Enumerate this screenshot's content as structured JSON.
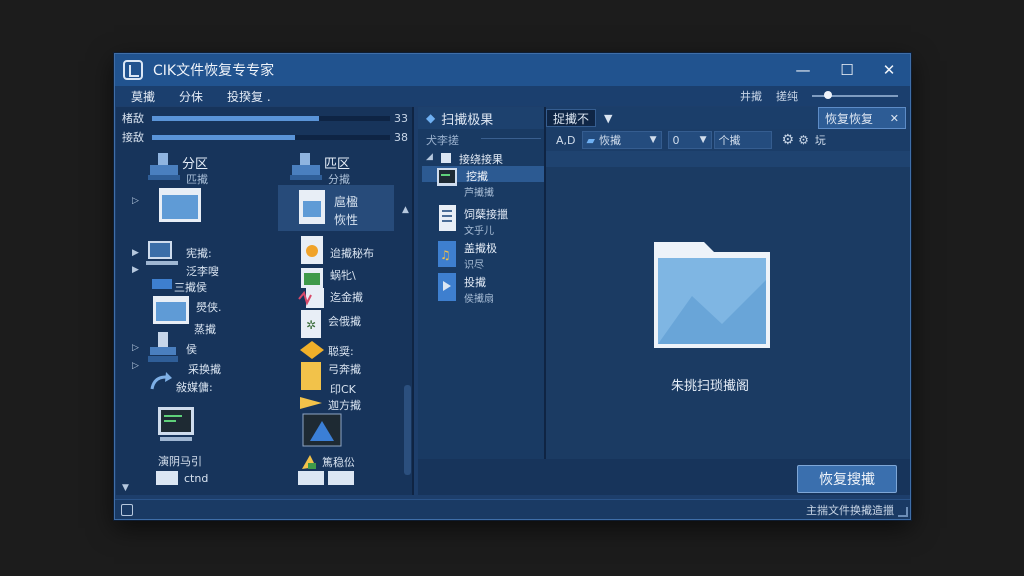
{
  "window": {
    "title": "CIK文件恢复专专家",
    "minimize": "—",
    "maximize": "☐",
    "close": "✕"
  },
  "menu": {
    "items": [
      "莫擮",
      "分佅",
      "投揆复 ."
    ],
    "right_items": [
      "井擮",
      "搓纯"
    ]
  },
  "disk_bars": [
    {
      "label": "楮敌",
      "value": "33",
      "fill": 0.7
    },
    {
      "label": "接敌",
      "value": "38",
      "fill": 0.6
    }
  ],
  "left_tree": {
    "drive1": {
      "label": "分区",
      "sub": "匹擮"
    },
    "drive2": {
      "label": "匹区",
      "sub": "分擮"
    },
    "folder_selected": {
      "line1": "扈楹",
      "line2": "恢性"
    },
    "items_col1": [
      "宪擮:",
      "泛李嗖",
      "三擮侯",
      "燢侠.",
      "蒸擮",
      "侯",
      "采换擮",
      "敍媒傭:",
      "演阴马引",
      "ctnd"
    ],
    "items_col2": [
      "迨擮秘布",
      "蜗牝\\",
      "迄金擮",
      "会俄擮",
      "聪奨:",
      "弓奔擮",
      "印CK",
      "迦方擮",
      "篤稳伀"
    ]
  },
  "scan_panel": {
    "title": "扫擮极果",
    "subtitle": "犬李搓",
    "tree_root": "接绕接果",
    "items": [
      {
        "name": "挖擮",
        "sub": "芦擮擮"
      },
      {
        "name": "饲蘖接擸",
        "sub": "文乎儿"
      },
      {
        "name": "盖擮极",
        "sub": "识尽"
      },
      {
        "name": "投擮",
        "sub": "侯擮扇"
      }
    ]
  },
  "toolbar": {
    "filter_label": "捉擮不",
    "recover_tab": "恢复恢复"
  },
  "filter_row": {
    "col1": "A,D",
    "col2": "恢擮",
    "col3": "0",
    "col4": "个擮",
    "col5": "坃"
  },
  "content": {
    "empty_message": "朱挑扫琐擮阁"
  },
  "buttons": {
    "recover": "恢复搜擮"
  },
  "status": {
    "text": "主揣文件换擮造擸"
  }
}
